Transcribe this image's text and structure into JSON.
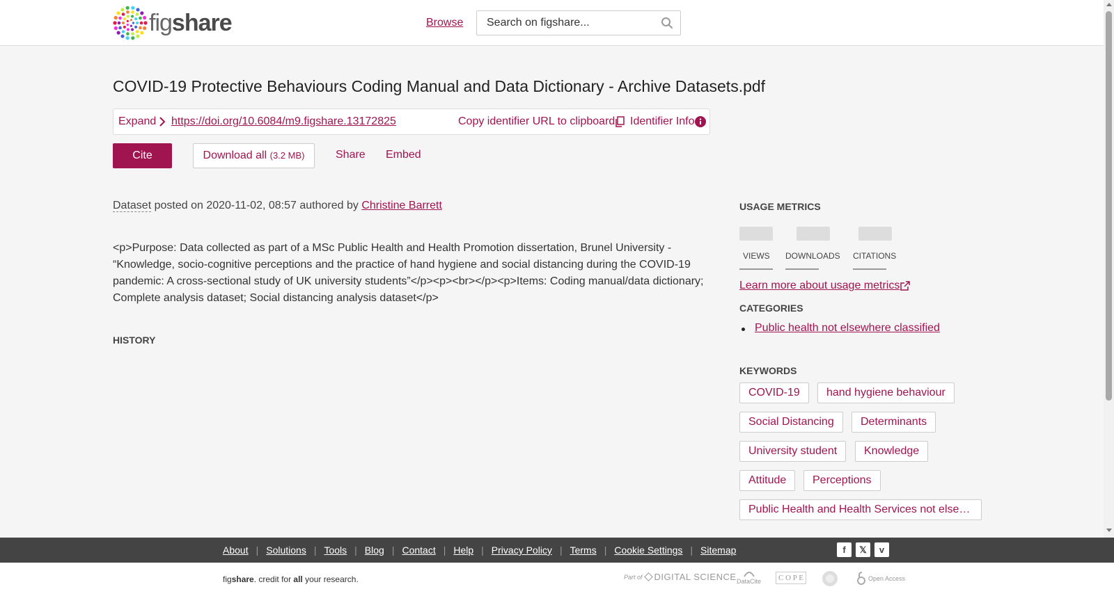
{
  "header": {
    "logo": {
      "light": "fig",
      "bold": "share"
    },
    "browse_label": "Browse",
    "search_placeholder": "Search on figshare..."
  },
  "item": {
    "title": "COVID-19 Protective Behaviours Coding Manual and Data Dictionary - Archive Datasets.pdf",
    "identifier": {
      "expand_label": "Expand",
      "doi_url": "https://doi.org/10.6084/m9.figshare.13172825",
      "copy_label": "Copy identifier URL to clipboard",
      "info_label": "Identifier Info"
    },
    "actions": {
      "cite": "Cite",
      "download_all": "Download all",
      "download_size": "(3.2 MB)",
      "share": "Share",
      "embed": "Embed"
    },
    "posted": {
      "type": "Dataset",
      "posted_on": " posted on ",
      "date": "2020-11-02, 08:57",
      "authored_by": " authored by ",
      "author": "Christine Barrett"
    },
    "description": "<p>Purpose: Data collected as part of a MSc Public Health and Health Promotion dissertation, Brunel University - “Knowledge, socio-cognitive perceptions and the practice of hand hygiene and social distancing during the COVID-19 pandemic: A cross-sectional study of UK university students”</p><p><br></p><p>Items: Coding manual/data dictionary; Complete analysis dataset; Social distancing analysis dataset</p>",
    "history_heading": "HISTORY"
  },
  "sidebar": {
    "usage_heading": "USAGE METRICS",
    "metrics": [
      {
        "label": "VIEWS"
      },
      {
        "label": "DOWNLOADS"
      },
      {
        "label": "CITATIONS"
      }
    ],
    "learn_more": "Learn more about usage metrics",
    "categories_heading": "CATEGORIES",
    "categories": [
      "Public health not elsewhere classified"
    ],
    "keywords_heading": "KEYWORDS",
    "keywords": [
      "COVID-19",
      "hand hygiene behaviour",
      "Social Distancing",
      "Determinants",
      "University student",
      "Knowledge",
      "Attitude",
      "Perceptions",
      "Public Health and Health Services not elsewhere classified"
    ]
  },
  "footer": {
    "links": [
      "About",
      "Solutions",
      "Tools",
      "Blog",
      "Contact",
      "Help",
      "Privacy Policy",
      "Terms",
      "Cookie Settings",
      "Sitemap"
    ],
    "social": [
      "facebook-icon",
      "x-icon",
      "vimeo-icon"
    ],
    "tagline": {
      "fig": "fig",
      "share": "share",
      "mid": ". credit for ",
      "all": "all",
      "end": " your research."
    },
    "partners": {
      "part_of": "Part of",
      "digital_science": "DIGITAL SCIENCE",
      "datacite": "DataCite",
      "cope": "C O P E",
      "open_access": "Open Access"
    }
  },
  "colors": {
    "accent": "#a0144f",
    "footer_dark": "#444444",
    "background": "#f5f5f5"
  }
}
